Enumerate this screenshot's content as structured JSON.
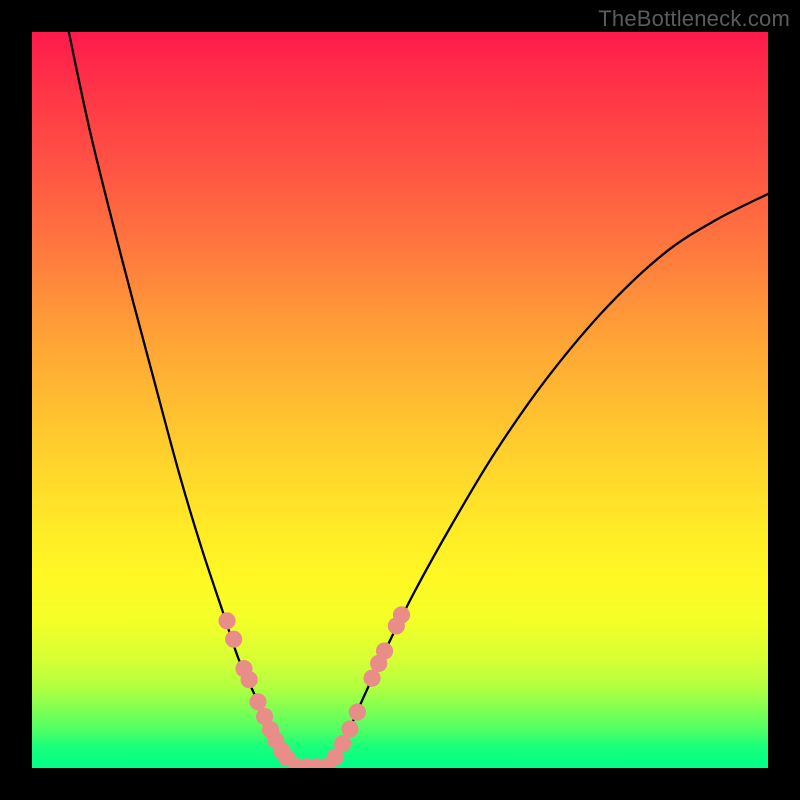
{
  "watermark": "TheBottleneck.com",
  "chart_data": {
    "type": "line",
    "title": "",
    "xlabel": "",
    "ylabel": "",
    "xlim": [
      0,
      100
    ],
    "ylim": [
      0,
      100
    ],
    "series": [
      {
        "name": "left-curve",
        "x": [
          5,
          8,
          12,
          16.5,
          20,
          23,
          26,
          28,
          30,
          32,
          33.5,
          35,
          36
        ],
        "y": [
          100,
          86,
          70,
          53,
          40,
          30,
          21,
          15,
          10.5,
          6.5,
          3.5,
          1.3,
          0
        ]
      },
      {
        "name": "right-curve",
        "x": [
          40,
          41.5,
          43,
          45,
          48,
          52,
          57,
          63,
          70,
          78,
          86,
          93,
          100
        ],
        "y": [
          0,
          2,
          5,
          9.5,
          16,
          24,
          33,
          43,
          53,
          62.5,
          70,
          74.5,
          78
        ]
      }
    ],
    "flat_bottom": {
      "x_from": 36,
      "x_to": 40,
      "y": 0
    },
    "dot_groups": [
      {
        "name": "left-upper-dots",
        "points": [
          {
            "x": 26.5,
            "y": 20.0
          },
          {
            "x": 27.4,
            "y": 17.5
          },
          {
            "x": 28.8,
            "y": 13.5
          },
          {
            "x": 29.5,
            "y": 12.0
          }
        ]
      },
      {
        "name": "left-lower-dots",
        "points": [
          {
            "x": 30.7,
            "y": 9.0
          },
          {
            "x": 31.6,
            "y": 7.0
          },
          {
            "x": 32.4,
            "y": 5.2
          },
          {
            "x": 33.1,
            "y": 3.8
          },
          {
            "x": 33.9,
            "y": 2.4
          },
          {
            "x": 34.6,
            "y": 1.4
          }
        ]
      },
      {
        "name": "bottom-dots",
        "points": [
          {
            "x": 36.0,
            "y": 0.15
          },
          {
            "x": 37.3,
            "y": 0.15
          },
          {
            "x": 38.7,
            "y": 0.15
          },
          {
            "x": 40.0,
            "y": 0.15
          }
        ]
      },
      {
        "name": "right-lower-dots",
        "points": [
          {
            "x": 41.2,
            "y": 1.5
          },
          {
            "x": 42.2,
            "y": 3.3
          },
          {
            "x": 43.2,
            "y": 5.3
          },
          {
            "x": 44.2,
            "y": 7.6
          }
        ]
      },
      {
        "name": "right-upper-dots",
        "points": [
          {
            "x": 46.2,
            "y": 12.2
          },
          {
            "x": 47.1,
            "y": 14.2
          },
          {
            "x": 47.9,
            "y": 15.9
          },
          {
            "x": 49.5,
            "y": 19.3
          },
          {
            "x": 50.2,
            "y": 20.8
          }
        ]
      }
    ],
    "colors": {
      "curve": "#000000",
      "dots": "#e98d88",
      "gradient_top": "#ff1a4d",
      "gradient_bottom": "#00ff88"
    }
  }
}
